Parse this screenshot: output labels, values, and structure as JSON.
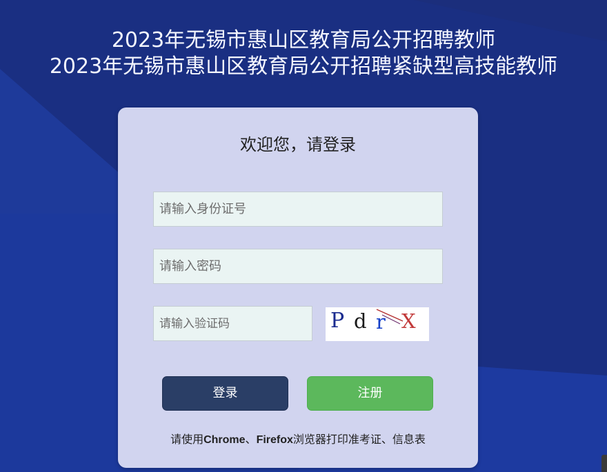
{
  "header": {
    "title_line1": "2023年无锡市惠山区教育局公开招聘教师",
    "title_line2": "2023年无锡市惠山区教育局公开招聘紧缺型高技能教师"
  },
  "login": {
    "welcome": "欢迎您，请登录",
    "id_placeholder": "请输入身份证号",
    "password_placeholder": "请输入密码",
    "captcha_placeholder": "请输入验证码",
    "captcha_text": [
      "P",
      "d",
      "r",
      "X"
    ],
    "login_label": "登录",
    "register_label": "注册"
  },
  "notice": {
    "prefix": "请使用",
    "browser1": "Chrome",
    "separator": "、",
    "browser2": "Firefox",
    "suffix": "浏览器打印准考证、信息表"
  },
  "colors": {
    "background": "#1c3285",
    "card": "#d1d4ef",
    "login_button": "#2a3e66",
    "register_button": "#5cb85c"
  }
}
